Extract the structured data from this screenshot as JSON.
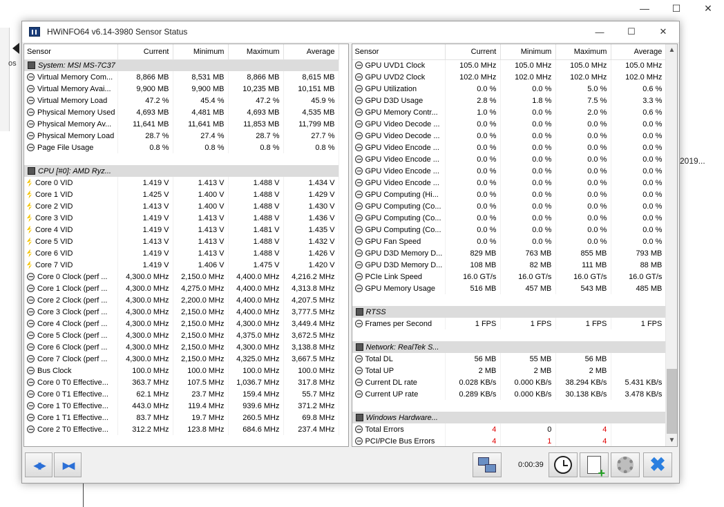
{
  "background": {
    "left_text": "os",
    "right_text": "2019..."
  },
  "window": {
    "title": "HWiNFO64 v6.14-3980 Sensor Status"
  },
  "columns": [
    "Sensor",
    "Current",
    "Minimum",
    "Maximum",
    "Average"
  ],
  "left_rows": [
    {
      "type": "group",
      "icon": "chip-icon",
      "label": "System: MSI MS-7C37"
    },
    {
      "type": "row",
      "icon": "gauge-icon",
      "label": "Virtual Memory Com...",
      "cur": "8,866 MB",
      "min": "8,531 MB",
      "max": "8,866 MB",
      "avg": "8,615 MB"
    },
    {
      "type": "row",
      "icon": "gauge-icon",
      "label": "Virtual Memory Avai...",
      "cur": "9,900 MB",
      "min": "9,900 MB",
      "max": "10,235 MB",
      "avg": "10,151 MB"
    },
    {
      "type": "row",
      "icon": "gauge-icon",
      "label": "Virtual Memory Load",
      "cur": "47.2 %",
      "min": "45.4 %",
      "max": "47.2 %",
      "avg": "45.9 %"
    },
    {
      "type": "row",
      "icon": "gauge-icon",
      "label": "Physical Memory Used",
      "cur": "4,693 MB",
      "min": "4,481 MB",
      "max": "4,693 MB",
      "avg": "4,535 MB"
    },
    {
      "type": "row",
      "icon": "gauge-icon",
      "label": "Physical Memory Av...",
      "cur": "11,641 MB",
      "min": "11,641 MB",
      "max": "11,853 MB",
      "avg": "11,799 MB"
    },
    {
      "type": "row",
      "icon": "gauge-icon",
      "label": "Physical Memory Load",
      "cur": "28.7 %",
      "min": "27.4 %",
      "max": "28.7 %",
      "avg": "27.7 %"
    },
    {
      "type": "row",
      "icon": "gauge-icon",
      "label": "Page File Usage",
      "cur": "0.8 %",
      "min": "0.8 %",
      "max": "0.8 %",
      "avg": "0.8 %"
    },
    {
      "type": "blank"
    },
    {
      "type": "group",
      "icon": "chip-icon",
      "label": "CPU [#0]: AMD Ryz..."
    },
    {
      "type": "row",
      "icon": "voltage-icon",
      "label": "Core 0 VID",
      "cur": "1.419 V",
      "min": "1.413 V",
      "max": "1.488 V",
      "avg": "1.434 V"
    },
    {
      "type": "row",
      "icon": "voltage-icon",
      "label": "Core 1 VID",
      "cur": "1.425 V",
      "min": "1.400 V",
      "max": "1.488 V",
      "avg": "1.429 V"
    },
    {
      "type": "row",
      "icon": "voltage-icon",
      "label": "Core 2 VID",
      "cur": "1.413 V",
      "min": "1.400 V",
      "max": "1.488 V",
      "avg": "1.430 V"
    },
    {
      "type": "row",
      "icon": "voltage-icon",
      "label": "Core 3 VID",
      "cur": "1.419 V",
      "min": "1.413 V",
      "max": "1.488 V",
      "avg": "1.436 V"
    },
    {
      "type": "row",
      "icon": "voltage-icon",
      "label": "Core 4 VID",
      "cur": "1.419 V",
      "min": "1.413 V",
      "max": "1.481 V",
      "avg": "1.435 V"
    },
    {
      "type": "row",
      "icon": "voltage-icon",
      "label": "Core 5 VID",
      "cur": "1.413 V",
      "min": "1.413 V",
      "max": "1.488 V",
      "avg": "1.432 V"
    },
    {
      "type": "row",
      "icon": "voltage-icon",
      "label": "Core 6 VID",
      "cur": "1.419 V",
      "min": "1.413 V",
      "max": "1.488 V",
      "avg": "1.426 V"
    },
    {
      "type": "row",
      "icon": "voltage-icon",
      "label": "Core 7 VID",
      "cur": "1.419 V",
      "min": "1.406 V",
      "max": "1.475 V",
      "avg": "1.420 V"
    },
    {
      "type": "row",
      "icon": "gauge-icon",
      "label": "Core 0 Clock (perf ...",
      "cur": "4,300.0 MHz",
      "min": "2,150.0 MHz",
      "max": "4,400.0 MHz",
      "avg": "4,216.2 MHz"
    },
    {
      "type": "row",
      "icon": "gauge-icon",
      "label": "Core 1 Clock (perf ...",
      "cur": "4,300.0 MHz",
      "min": "4,275.0 MHz",
      "max": "4,400.0 MHz",
      "avg": "4,313.8 MHz"
    },
    {
      "type": "row",
      "icon": "gauge-icon",
      "label": "Core 2 Clock (perf ...",
      "cur": "4,300.0 MHz",
      "min": "2,200.0 MHz",
      "max": "4,400.0 MHz",
      "avg": "4,207.5 MHz"
    },
    {
      "type": "row",
      "icon": "gauge-icon",
      "label": "Core 3 Clock (perf ...",
      "cur": "4,300.0 MHz",
      "min": "2,150.0 MHz",
      "max": "4,400.0 MHz",
      "avg": "3,777.5 MHz"
    },
    {
      "type": "row",
      "icon": "gauge-icon",
      "label": "Core 4 Clock (perf ...",
      "cur": "4,300.0 MHz",
      "min": "2,150.0 MHz",
      "max": "4,300.0 MHz",
      "avg": "3,449.4 MHz"
    },
    {
      "type": "row",
      "icon": "gauge-icon",
      "label": "Core 5 Clock (perf ...",
      "cur": "4,300.0 MHz",
      "min": "2,150.0 MHz",
      "max": "4,375.0 MHz",
      "avg": "3,672.5 MHz"
    },
    {
      "type": "row",
      "icon": "gauge-icon",
      "label": "Core 6 Clock (perf ...",
      "cur": "4,300.0 MHz",
      "min": "2,150.0 MHz",
      "max": "4,300.0 MHz",
      "avg": "3,138.8 MHz"
    },
    {
      "type": "row",
      "icon": "gauge-icon",
      "label": "Core 7 Clock (perf ...",
      "cur": "4,300.0 MHz",
      "min": "2,150.0 MHz",
      "max": "4,325.0 MHz",
      "avg": "3,667.5 MHz"
    },
    {
      "type": "row",
      "icon": "gauge-icon",
      "label": "Bus Clock",
      "cur": "100.0 MHz",
      "min": "100.0 MHz",
      "max": "100.0 MHz",
      "avg": "100.0 MHz"
    },
    {
      "type": "row",
      "icon": "gauge-icon",
      "label": "Core 0 T0 Effective...",
      "cur": "363.7 MHz",
      "min": "107.5 MHz",
      "max": "1,036.7 MHz",
      "avg": "317.8 MHz"
    },
    {
      "type": "row",
      "icon": "gauge-icon",
      "label": "Core 0 T1 Effective...",
      "cur": "62.1 MHz",
      "min": "23.7 MHz",
      "max": "159.4 MHz",
      "avg": "55.7 MHz"
    },
    {
      "type": "row",
      "icon": "gauge-icon",
      "label": "Core 1 T0 Effective...",
      "cur": "443.0 MHz",
      "min": "119.4 MHz",
      "max": "939.6 MHz",
      "avg": "371.2 MHz"
    },
    {
      "type": "row",
      "icon": "gauge-icon",
      "label": "Core 1 T1 Effective...",
      "cur": "83.7 MHz",
      "min": "19.7 MHz",
      "max": "260.5 MHz",
      "avg": "69.8 MHz"
    },
    {
      "type": "row",
      "icon": "gauge-icon",
      "label": "Core 2 T0 Effective...",
      "cur": "312.2 MHz",
      "min": "123.8 MHz",
      "max": "684.6 MHz",
      "avg": "237.4 MHz"
    }
  ],
  "right_rows": [
    {
      "type": "row",
      "icon": "gauge-icon",
      "label": "GPU UVD1 Clock",
      "cur": "105.0 MHz",
      "min": "105.0 MHz",
      "max": "105.0 MHz",
      "avg": "105.0 MHz"
    },
    {
      "type": "row",
      "icon": "gauge-icon",
      "label": "GPU UVD2 Clock",
      "cur": "102.0 MHz",
      "min": "102.0 MHz",
      "max": "102.0 MHz",
      "avg": "102.0 MHz"
    },
    {
      "type": "row",
      "icon": "gauge-icon",
      "label": "GPU Utilization",
      "cur": "0.0 %",
      "min": "0.0 %",
      "max": "5.0 %",
      "avg": "0.6 %"
    },
    {
      "type": "row",
      "icon": "gauge-icon",
      "label": "GPU D3D Usage",
      "cur": "2.8 %",
      "min": "1.8 %",
      "max": "7.5 %",
      "avg": "3.3 %"
    },
    {
      "type": "row",
      "icon": "gauge-icon",
      "label": "GPU Memory Contr...",
      "cur": "1.0 %",
      "min": "0.0 %",
      "max": "2.0 %",
      "avg": "0.6 %"
    },
    {
      "type": "row",
      "icon": "gauge-icon",
      "label": "GPU Video Decode ...",
      "cur": "0.0 %",
      "min": "0.0 %",
      "max": "0.0 %",
      "avg": "0.0 %"
    },
    {
      "type": "row",
      "icon": "gauge-icon",
      "label": "GPU Video Decode ...",
      "cur": "0.0 %",
      "min": "0.0 %",
      "max": "0.0 %",
      "avg": "0.0 %"
    },
    {
      "type": "row",
      "icon": "gauge-icon",
      "label": "GPU Video Encode ...",
      "cur": "0.0 %",
      "min": "0.0 %",
      "max": "0.0 %",
      "avg": "0.0 %"
    },
    {
      "type": "row",
      "icon": "gauge-icon",
      "label": "GPU Video Encode ...",
      "cur": "0.0 %",
      "min": "0.0 %",
      "max": "0.0 %",
      "avg": "0.0 %"
    },
    {
      "type": "row",
      "icon": "gauge-icon",
      "label": "GPU Video Encode ...",
      "cur": "0.0 %",
      "min": "0.0 %",
      "max": "0.0 %",
      "avg": "0.0 %"
    },
    {
      "type": "row",
      "icon": "gauge-icon",
      "label": "GPU Video Encode ...",
      "cur": "0.0 %",
      "min": "0.0 %",
      "max": "0.0 %",
      "avg": "0.0 %"
    },
    {
      "type": "row",
      "icon": "gauge-icon",
      "label": "GPU Computing (Hi...",
      "cur": "0.0 %",
      "min": "0.0 %",
      "max": "0.0 %",
      "avg": "0.0 %"
    },
    {
      "type": "row",
      "icon": "gauge-icon",
      "label": "GPU Computing (Co...",
      "cur": "0.0 %",
      "min": "0.0 %",
      "max": "0.0 %",
      "avg": "0.0 %"
    },
    {
      "type": "row",
      "icon": "gauge-icon",
      "label": "GPU Computing (Co...",
      "cur": "0.0 %",
      "min": "0.0 %",
      "max": "0.0 %",
      "avg": "0.0 %"
    },
    {
      "type": "row",
      "icon": "gauge-icon",
      "label": "GPU Computing (Co...",
      "cur": "0.0 %",
      "min": "0.0 %",
      "max": "0.0 %",
      "avg": "0.0 %"
    },
    {
      "type": "row",
      "icon": "gauge-icon",
      "label": "GPU Fan Speed",
      "cur": "0.0 %",
      "min": "0.0 %",
      "max": "0.0 %",
      "avg": "0.0 %"
    },
    {
      "type": "row",
      "icon": "gauge-icon",
      "label": "GPU D3D Memory D...",
      "cur": "829 MB",
      "min": "763 MB",
      "max": "855 MB",
      "avg": "793 MB"
    },
    {
      "type": "row",
      "icon": "gauge-icon",
      "label": "GPU D3D Memory D...",
      "cur": "108 MB",
      "min": "82 MB",
      "max": "111 MB",
      "avg": "88 MB"
    },
    {
      "type": "row",
      "icon": "gauge-icon",
      "label": "PCIe Link Speed",
      "cur": "16.0 GT/s",
      "min": "16.0 GT/s",
      "max": "16.0 GT/s",
      "avg": "16.0 GT/s"
    },
    {
      "type": "row",
      "icon": "gauge-icon",
      "label": "GPU Memory Usage",
      "cur": "516 MB",
      "min": "457 MB",
      "max": "543 MB",
      "avg": "485 MB"
    },
    {
      "type": "blank"
    },
    {
      "type": "group",
      "icon": "chip-icon",
      "label": "RTSS"
    },
    {
      "type": "row",
      "icon": "gauge-icon",
      "label": "Frames per Second",
      "cur": "1 FPS",
      "min": "1 FPS",
      "max": "1 FPS",
      "avg": "1 FPS"
    },
    {
      "type": "blank"
    },
    {
      "type": "group",
      "icon": "chip-icon",
      "label": "Network: RealTek S..."
    },
    {
      "type": "row",
      "icon": "gauge-icon",
      "label": "Total DL",
      "cur": "56 MB",
      "min": "55 MB",
      "max": "56 MB",
      "avg": ""
    },
    {
      "type": "row",
      "icon": "gauge-icon",
      "label": "Total UP",
      "cur": "2 MB",
      "min": "2 MB",
      "max": "2 MB",
      "avg": ""
    },
    {
      "type": "row",
      "icon": "gauge-icon",
      "label": "Current DL rate",
      "cur": "0.028 KB/s",
      "min": "0.000 KB/s",
      "max": "38.294 KB/s",
      "avg": "5.431 KB/s"
    },
    {
      "type": "row",
      "icon": "gauge-icon",
      "label": "Current UP rate",
      "cur": "0.289 KB/s",
      "min": "0.000 KB/s",
      "max": "30.138 KB/s",
      "avg": "3.478 KB/s"
    },
    {
      "type": "blank"
    },
    {
      "type": "group",
      "icon": "chip-icon",
      "label": "Windows Hardware..."
    },
    {
      "type": "row",
      "icon": "gauge-icon",
      "label": "Total Errors",
      "cur": "4",
      "min": "0",
      "max": "4",
      "avg": "",
      "red": [
        "cur",
        "max"
      ]
    },
    {
      "type": "row",
      "icon": "gauge-icon",
      "label": "PCI/PCIe Bus Errors",
      "cur": "4",
      "min": "1",
      "max": "4",
      "avg": "",
      "red": [
        "cur",
        "min",
        "max"
      ]
    }
  ],
  "toolbar": {
    "timer": "0:00:39"
  },
  "colors": {
    "error_red": "#e00000",
    "group_bg": "#dcdcdc",
    "accent_blue": "#2b6fd6"
  }
}
